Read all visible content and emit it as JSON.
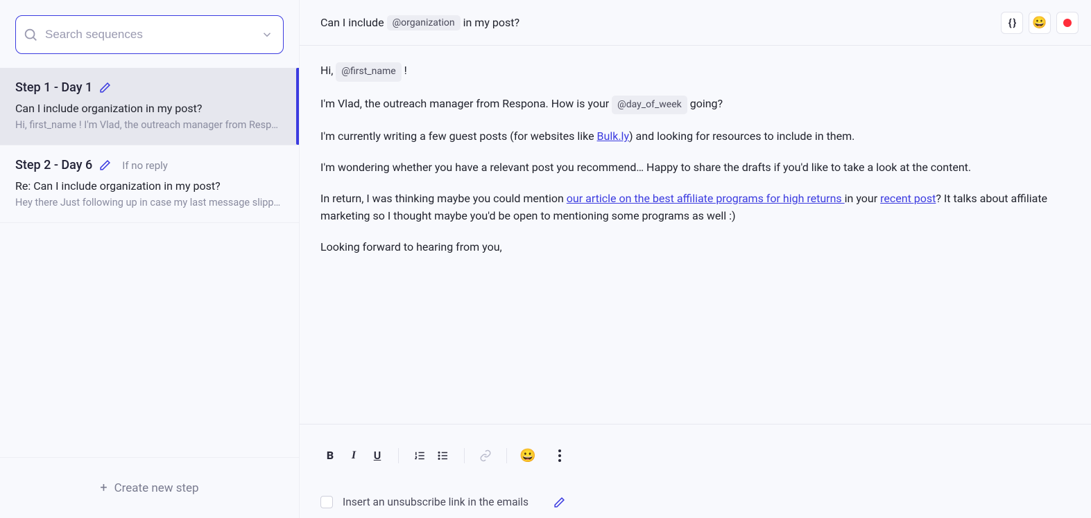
{
  "sidebar": {
    "search_placeholder": "Search sequences",
    "steps": [
      {
        "title": "Step 1 - Day 1",
        "condition": "",
        "subject": "Can I include organization in my post?",
        "preview": "Hi, first_name ! I'm Vlad, the outreach manager from Respon…"
      },
      {
        "title": "Step 2 - Day 6",
        "condition": "If no reply",
        "subject": "Re: Can I include organization in my post?",
        "preview": "Hey there Just following up in case my last message slipped …"
      }
    ],
    "create_label": "Create new step"
  },
  "subject": {
    "pre": "Can I include",
    "var": "@organization",
    "post": "in my post?"
  },
  "body": {
    "greet_pre": "Hi,",
    "greet_var": "@first_name",
    "greet_post": "!",
    "p2_pre": "I'm Vlad, the outreach manager from Respona. How is your",
    "p2_var": "@day_of_week",
    "p2_post": "going?",
    "p3_pre": "I'm currently writing a few guest posts (for websites like ",
    "p3_link": "Bulk.ly",
    "p3_post": ") and looking for resources to include in them.",
    "p4": "I'm wondering whether you have a relevant post you recommend… Happy to share the drafts if you'd like to take a look at the content.",
    "p5_pre": "In return, I was thinking maybe you could mention ",
    "p5_link1": "our article on the best affiliate programs for high returns ",
    "p5_mid": "in your ",
    "p5_link2": "recent post",
    "p5_post": "? It talks about affiliate marketing so I thought maybe you'd be open to mentioning some programs as well :)",
    "p6": "Looking forward to hearing from you,"
  },
  "toolbar": {
    "bold": "B",
    "italic": "I",
    "under": "U"
  },
  "footer": {
    "unsub_label": "Insert an unsubscribe link in the emails"
  }
}
